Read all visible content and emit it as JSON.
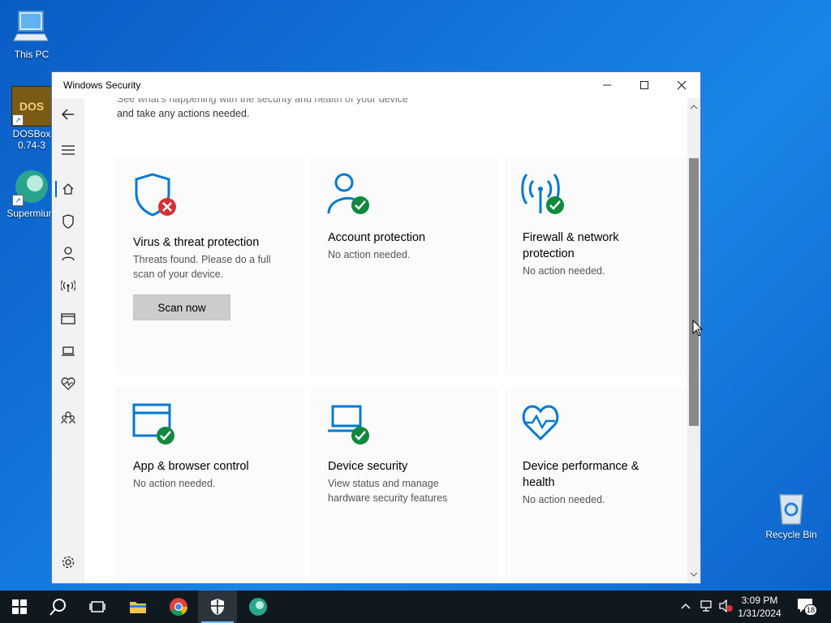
{
  "desktop": {
    "icons": [
      {
        "label": "This PC"
      },
      {
        "label_line1": "DOSBox",
        "label_line2": "0.74-3",
        "logo_text": "DOS"
      },
      {
        "label": "Supermium"
      },
      {
        "label": "Recycle Bin"
      }
    ]
  },
  "window": {
    "title": "Windows Security",
    "controls": {
      "minimize": "minimize",
      "maximize": "maximize",
      "close": "close"
    }
  },
  "sidebar": {
    "items": [
      "back",
      "menu",
      "home",
      "virus-protection",
      "account",
      "firewall",
      "app-browser",
      "device-security",
      "device-performance",
      "family",
      "settings"
    ],
    "selected": "home"
  },
  "content": {
    "intro_line1": "See what's happening with the security and health of your device",
    "intro_line2": "and take any actions needed.",
    "tiles": [
      {
        "title": "Virus & threat protection",
        "desc": "Threats found. Please do a full scan of your device.",
        "button": "Scan now",
        "status": "error"
      },
      {
        "title": "Account protection",
        "desc": "No action needed.",
        "status": "ok"
      },
      {
        "title": "Firewall & network protection",
        "desc": "No action needed.",
        "status": "ok"
      },
      {
        "title": "App & browser control",
        "desc": "No action needed.",
        "status": "ok"
      },
      {
        "title": "Device security",
        "desc": "View status and manage hardware security features",
        "status": "ok"
      },
      {
        "title": "Device performance & health",
        "desc": "No action needed.",
        "status": "ok"
      }
    ]
  },
  "taskbar": {
    "items": [
      "start",
      "search",
      "task-view",
      "file-explorer",
      "chrome",
      "windows-security",
      "supermium"
    ],
    "active": "windows-security",
    "time": "3:09 PM",
    "date": "1/31/2024",
    "notification_count": "18"
  },
  "colors": {
    "accent": "#0067c0",
    "ok": "#10893e",
    "error": "#d13438",
    "icon_blue": "#0078d4"
  }
}
